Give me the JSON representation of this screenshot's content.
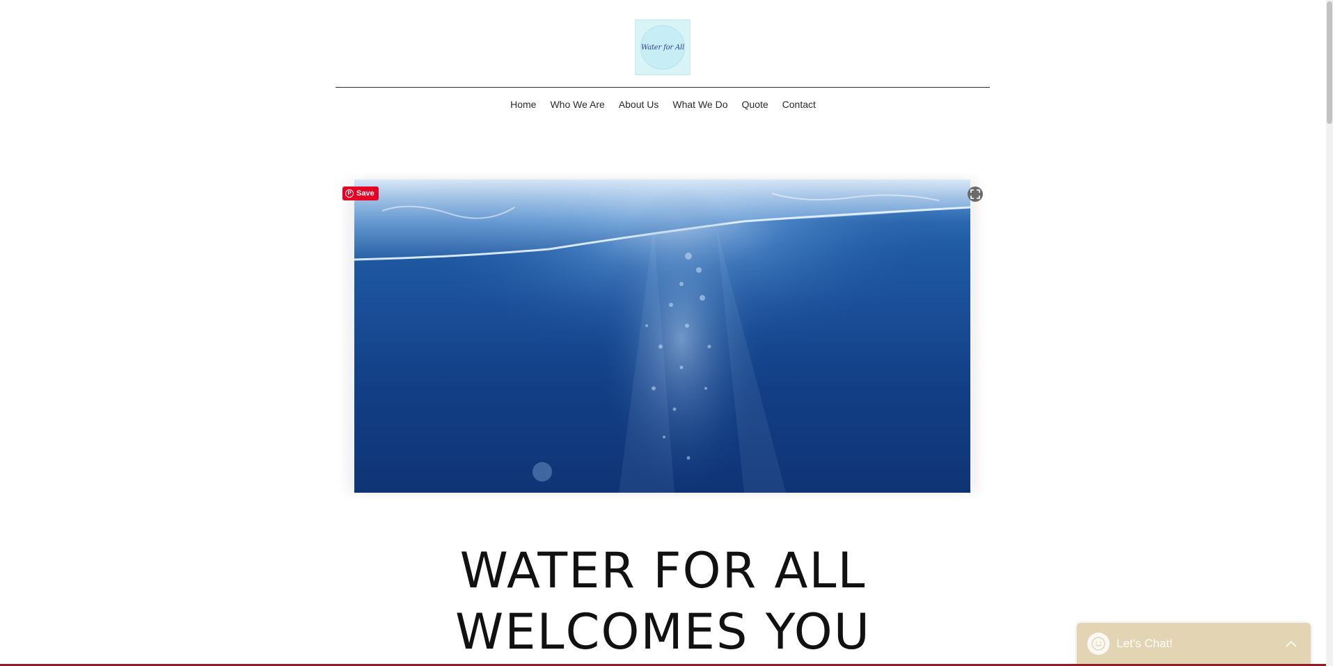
{
  "logo": {
    "text": "Water for All",
    "icon": "water-for-all-logo"
  },
  "nav": {
    "items": [
      {
        "label": "Home"
      },
      {
        "label": "Who We Are"
      },
      {
        "label": "About Us"
      },
      {
        "label": "What We Do"
      },
      {
        "label": "Quote"
      },
      {
        "label": "Contact"
      }
    ]
  },
  "hero": {
    "image": "underwater-bubbles-photo",
    "pin_save_label": "Save",
    "pin_icon": "pinterest-icon",
    "expand_icon": "expand-icon"
  },
  "headline": {
    "line1": "WATER FOR ALL",
    "line2": "WELCOMES YOU"
  },
  "chat": {
    "label": "Let's Chat!",
    "avatar_icon": "chat-smile-icon",
    "chevron_icon": "chevron-up-icon",
    "background_color": "#e3d4b3"
  },
  "colors": {
    "pinterest_red": "#e60023",
    "text": "#2b2b2b",
    "logo_bg": "#d8f4f6"
  }
}
